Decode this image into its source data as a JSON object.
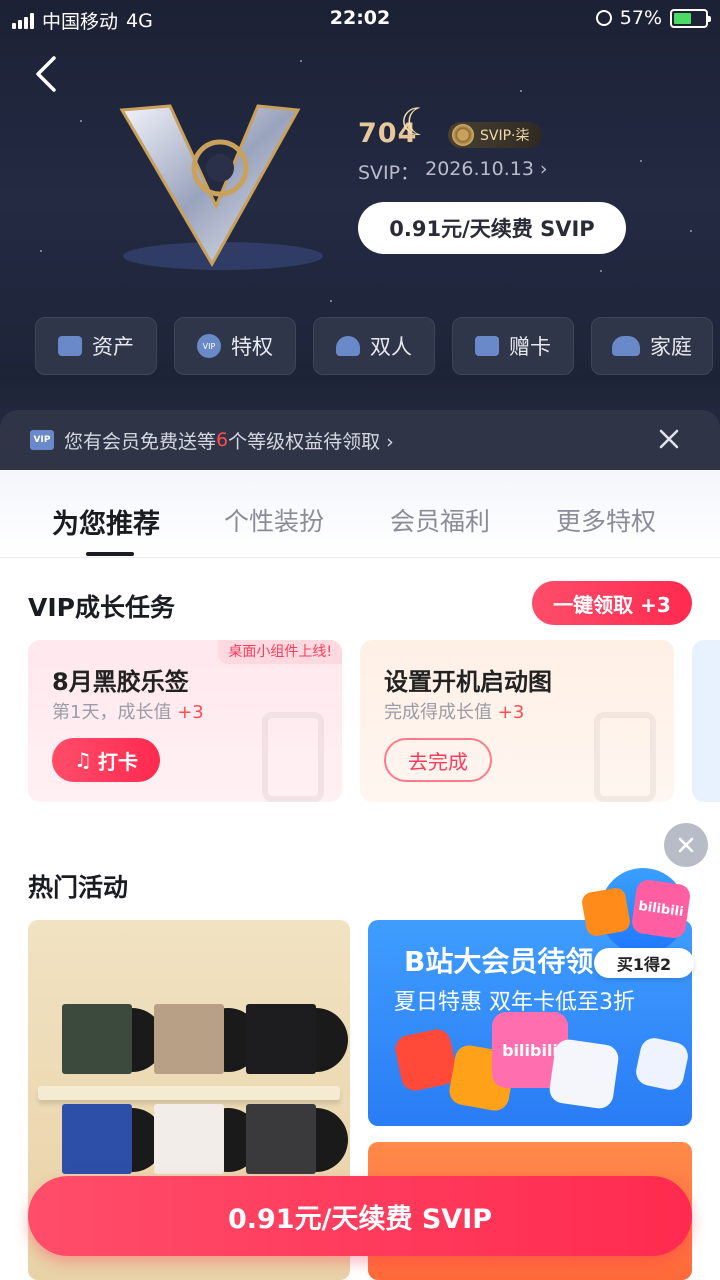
{
  "status_bar": {
    "carrier": "中国移动",
    "network": "4G",
    "time": "22:02",
    "battery": "57%"
  },
  "profile": {
    "username": "704",
    "badge_label": "SVIP·柒",
    "expiry_label": "SVIP：",
    "expiry_date": "2026.10.13",
    "renew_label": "0.91元/天续费 SVIP"
  },
  "quick_actions": [
    {
      "label": "资产",
      "icon": "wallet-icon"
    },
    {
      "label": "特权",
      "icon": "vip-icon"
    },
    {
      "label": "双人",
      "icon": "person-icon"
    },
    {
      "label": "赠卡",
      "icon": "gift-card-icon"
    },
    {
      "label": "家庭",
      "icon": "family-icon"
    }
  ],
  "notice": {
    "text_before": "您有会员免费送等",
    "count": "6",
    "text_after": "个等级权益待领取 ›"
  },
  "tabs": [
    {
      "label": "为您推荐",
      "active": true
    },
    {
      "label": "个性装扮",
      "active": false
    },
    {
      "label": "会员福利",
      "active": false
    },
    {
      "label": "更多特权",
      "active": false
    }
  ],
  "tasks": {
    "title": "VIP成长任务",
    "claim_all": "一键领取 +3",
    "items": [
      {
        "tag": "桌面小组件上线!",
        "title": "8月黑胶乐签",
        "sub_text": "第1天，成长值",
        "sub_bonus": "+3",
        "button": "打卡"
      },
      {
        "title": "设置开机启动图",
        "sub_text": "完成得成长值",
        "sub_bonus": "+3",
        "button": "去完成"
      }
    ]
  },
  "hot": {
    "title": "热门活动",
    "card2_title": "B站大会员待领",
    "card2_sub": "夏日特惠 双年卡低至3折",
    "float_tag": "买1得2",
    "bili_label": "bilibili"
  },
  "bottom_cta": "0.91元/天续费 SVIP",
  "colors": {
    "accent": "#ff2a4f",
    "gold": "#e8c89b",
    "hero_bg": "#1c2135"
  }
}
